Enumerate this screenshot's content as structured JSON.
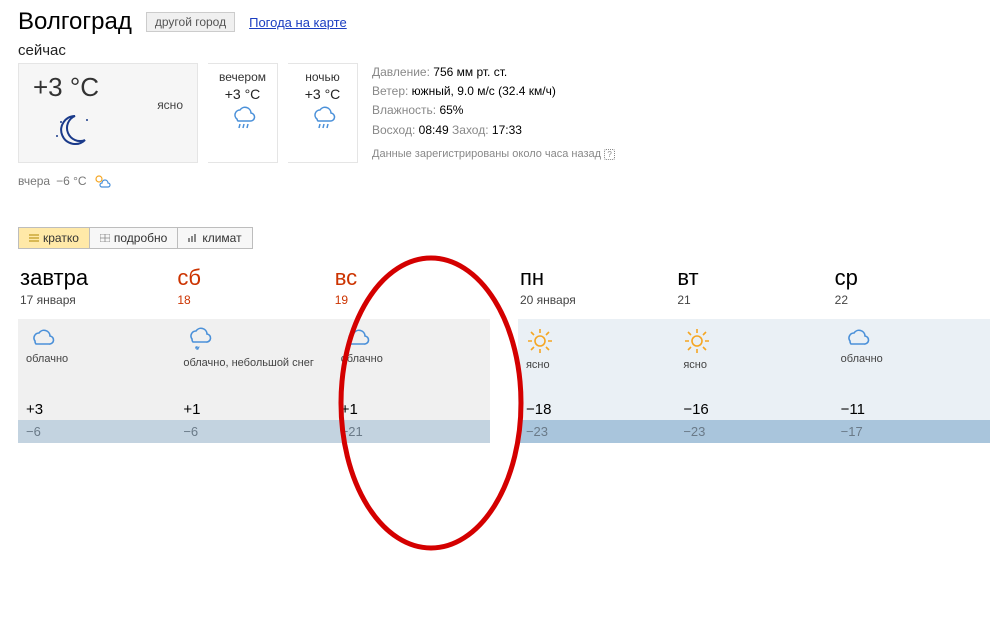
{
  "header": {
    "city": "Волгоград",
    "other_city_label": "другой город",
    "map_link_label": "Погода на карте"
  },
  "now": {
    "label": "сейчас",
    "temp": "+3 °C",
    "condition": "ясно",
    "parts": [
      {
        "label": "вечером",
        "temp": "+3 °C",
        "icon": "rain-cloud-icon"
      },
      {
        "label": "ночью",
        "temp": "+3 °C",
        "icon": "rain-cloud-icon"
      }
    ]
  },
  "details": {
    "pressure_k": "Давление:",
    "pressure_v": "756 мм рт. ст.",
    "wind_k": "Ветер:",
    "wind_v": "южный, 9.0 м/с (32.4 км/ч)",
    "humidity_k": "Влажность:",
    "humidity_v": "65%",
    "sunrise_k": "Восход:",
    "sunrise_v": "08:49",
    "sunset_k": "Заход:",
    "sunset_v": "17:33",
    "age": "Данные зарегистрированы около часа назад"
  },
  "yesterday": {
    "label": "вчера",
    "temp": "−6 °C"
  },
  "tabs": [
    {
      "label": "кратко",
      "active": true,
      "icon": "list-icon"
    },
    {
      "label": "подробно",
      "active": false,
      "icon": "table-icon"
    },
    {
      "label": "климат",
      "active": false,
      "icon": "bars-icon"
    }
  ],
  "forecast": [
    {
      "name": "завтра",
      "date": "17 января",
      "weekend": false,
      "cond": "облачно",
      "icon": "cloud",
      "hi": "+3",
      "lo": "−6",
      "tmr": true
    },
    {
      "name": "сб",
      "date": "18",
      "weekend": true,
      "cond": "облачно, небольшой снег",
      "icon": "cloud-snow",
      "hi": "+1",
      "lo": "−6",
      "tmr": true
    },
    {
      "name": "вс",
      "date": "19",
      "weekend": true,
      "cond": "облачно",
      "icon": "cloud",
      "hi": "+1",
      "lo": "−21",
      "tmr": true
    },
    {
      "name": "пн",
      "date": "20 января",
      "weekend": false,
      "cond": "ясно",
      "icon": "sun",
      "hi": "−18",
      "lo": "−23",
      "tmr": false
    },
    {
      "name": "вт",
      "date": "21",
      "weekend": false,
      "cond": "ясно",
      "icon": "sun",
      "hi": "−16",
      "lo": "−23",
      "tmr": false
    },
    {
      "name": "ср",
      "date": "22",
      "weekend": false,
      "cond": "облачно",
      "icon": "cloud",
      "hi": "−11",
      "lo": "−17",
      "tmr": false
    }
  ]
}
